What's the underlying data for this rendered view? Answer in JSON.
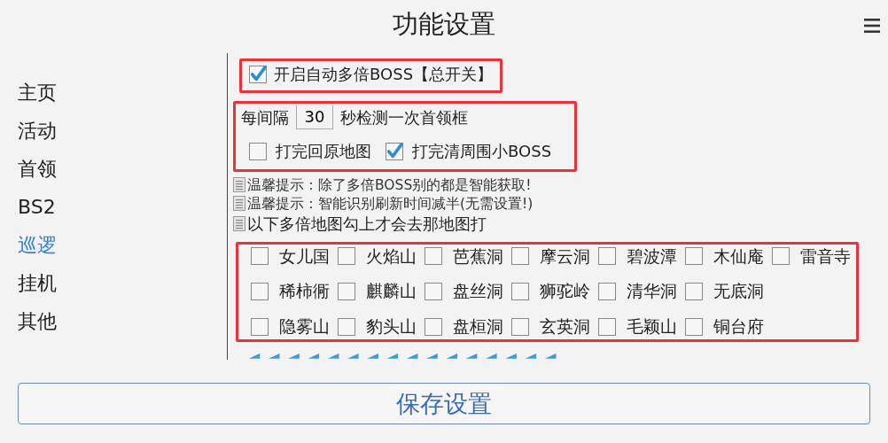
{
  "title": "功能设置",
  "sidebar": {
    "items": [
      {
        "label": "主页",
        "selected": false
      },
      {
        "label": "活动",
        "selected": false
      },
      {
        "label": "首领",
        "selected": false
      },
      {
        "label": "BS2",
        "selected": false
      },
      {
        "label": "巡逻",
        "selected": true
      },
      {
        "label": "挂机",
        "selected": false
      },
      {
        "label": "其他",
        "selected": false
      }
    ]
  },
  "master_switch": {
    "label": "开启自动多倍BOSS【总开关】",
    "checked": true
  },
  "interval": {
    "prefix": "每间隔",
    "value": "30",
    "suffix": "秒检测一次首领框"
  },
  "options": [
    {
      "label": "打完回原地图",
      "checked": false
    },
    {
      "label": "打完清周围小BOSS",
      "checked": true
    }
  ],
  "tips": [
    "温馨提示：除了多倍BOSS别的都是智能获取!",
    "温馨提示：智能识别刷新时间减半(无需设置!)",
    "以下多倍地图勾上才会去那地图打"
  ],
  "maps": [
    [
      {
        "label": "女儿国",
        "checked": false
      },
      {
        "label": "火焰山",
        "checked": false
      },
      {
        "label": "芭蕉洞",
        "checked": false
      },
      {
        "label": "摩云洞",
        "checked": false
      },
      {
        "label": "碧波潭",
        "checked": false
      },
      {
        "label": "木仙庵",
        "checked": false
      },
      {
        "label": "雷音寺",
        "checked": false
      }
    ],
    [
      {
        "label": "稀柿衕",
        "checked": false
      },
      {
        "label": "麒麟山",
        "checked": false
      },
      {
        "label": "盘丝洞",
        "checked": false
      },
      {
        "label": "狮驼岭",
        "checked": false
      },
      {
        "label": "清华洞",
        "checked": false
      },
      {
        "label": "无底洞",
        "checked": false
      }
    ],
    [
      {
        "label": "隐雾山",
        "checked": false
      },
      {
        "label": "豹头山",
        "checked": false
      },
      {
        "label": "盘桓洞",
        "checked": false
      },
      {
        "label": "玄英洞",
        "checked": false
      },
      {
        "label": "毛颖山",
        "checked": false
      },
      {
        "label": "铜台府",
        "checked": false
      }
    ]
  ],
  "save_button": "保存设置"
}
